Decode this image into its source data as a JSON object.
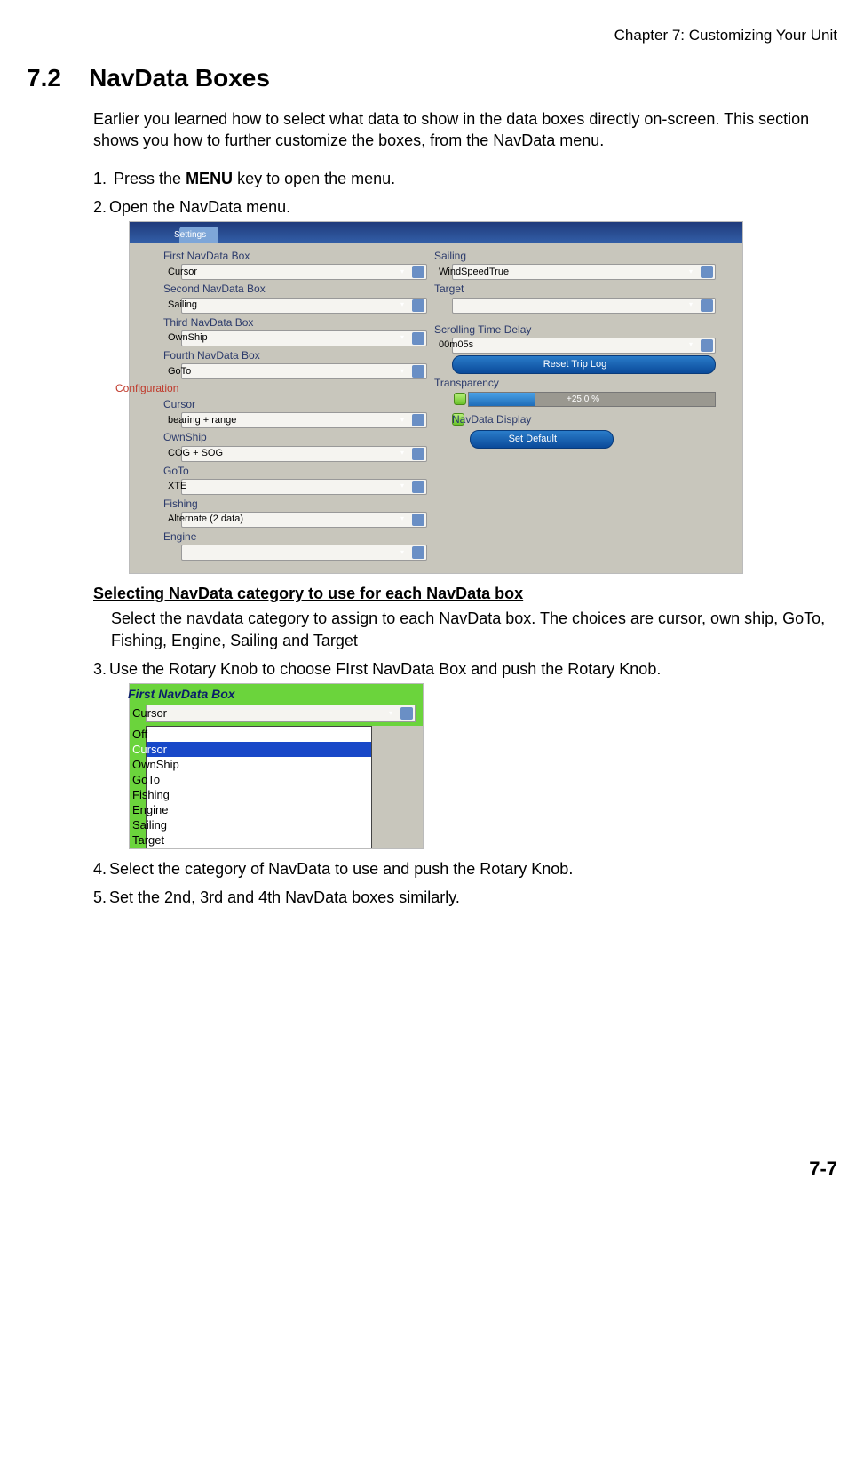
{
  "header": {
    "chapter": "Chapter 7: Customizing Your Unit"
  },
  "section": {
    "number": "7.2",
    "title": "NavData Boxes"
  },
  "intro": "Earlier you learned how to select what data to show in the data boxes directly on-screen. This section shows you how to further customize the boxes, from the NavData menu.",
  "steps": {
    "s1_a": "Press the ",
    "s1_b": "MENU",
    "s1_c": " key to open the menu.",
    "s2": "Open the NavData menu.",
    "s3": "Use the Rotary Knob to choose FIrst NavData Box and push the Rotary Knob.",
    "s4": "Select the category of NavData to use and push the Rotary Knob.",
    "s5": "Set the 2nd, 3rd and 4th NavData boxes similarly."
  },
  "subsection": {
    "title": "Selecting NavData category to use for each NavData box",
    "body": "Select the navdata category to assign to each NavData box. The choices are cursor, own ship, GoTo, Fishing, Engine, Sailing and Target"
  },
  "panel1": {
    "tab": "Settings",
    "left": {
      "l1": "First NavData Box",
      "v1": "Cursor",
      "l2": "Second NavData Box",
      "v2": "Sailing",
      "l3": "Third NavData Box",
      "v3": "OwnShip",
      "l4": "Fourth NavData Box",
      "v4": "GoTo",
      "cfg": "Configuration",
      "l5": "Cursor",
      "v5": "bearing + range",
      "l6": "OwnShip",
      "v6": "COG + SOG",
      "l7": "GoTo",
      "v7": "XTE",
      "l8": "Fishing",
      "v8": "Alternate (2 data)",
      "l9": "Engine",
      "v9": ""
    },
    "right": {
      "l1": "Sailing",
      "v1": "WindSpeedTrue",
      "l2": "Target",
      "v2": "",
      "l3": "Scrolling Time Delay",
      "v3": "00m05s",
      "btn1": "Reset Trip Log",
      "l4": "Transparency",
      "prog": "+25.0 %",
      "chk": "NavData Display",
      "btn2": "Set Default"
    }
  },
  "panel2": {
    "title": "First NavData Box",
    "selected": "Cursor",
    "options": [
      "Off",
      "Cursor",
      "OwnShip",
      "GoTo",
      "Fishing",
      "Engine",
      "Sailing",
      "Target"
    ],
    "hilite_index": 1
  },
  "footer": {
    "page": "7-7"
  }
}
